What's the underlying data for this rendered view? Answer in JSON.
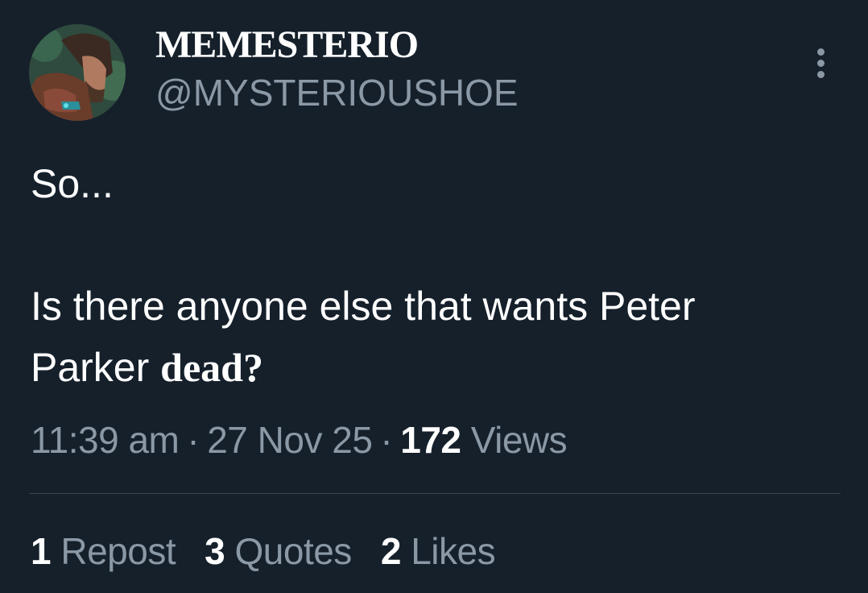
{
  "author": {
    "display_name": "MEMESTERIO",
    "handle": "@MYSTERIOUSHOE"
  },
  "tweet": {
    "line1": "So...",
    "line2": "Is there anyone else that wants Peter",
    "line3_prefix": "Parker ",
    "line3_stylized": "dead",
    "line3_suffix": "?"
  },
  "meta": {
    "time": "11:39 am",
    "date": "27 Nov 25",
    "separator": "·",
    "views_count": "172",
    "views_label": "Views"
  },
  "stats": {
    "reposts_count": "1",
    "reposts_label": "Repost",
    "quotes_count": "3",
    "quotes_label": "Quotes",
    "likes_count": "2",
    "likes_label": "Likes"
  },
  "icons": {
    "more": "more-vertical-icon"
  },
  "colors": {
    "background": "#15202b",
    "primary_text": "#ffffff",
    "secondary_text": "#8b98a5",
    "divider": "#38444d"
  }
}
